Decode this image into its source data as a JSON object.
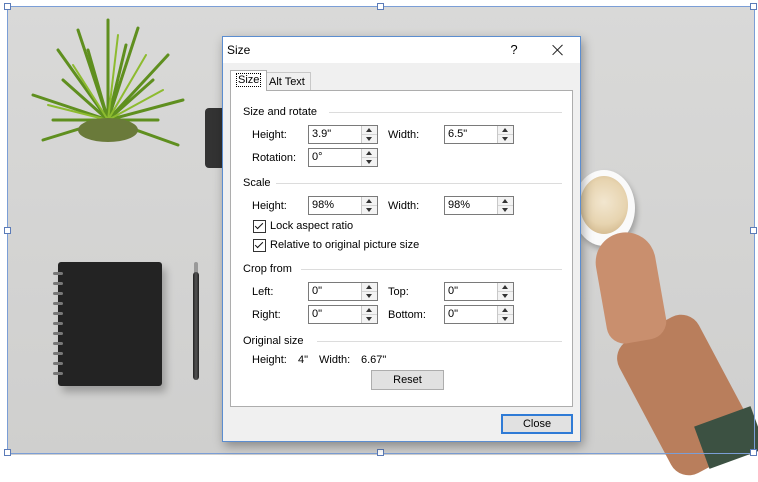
{
  "dialog": {
    "title": "Size",
    "help": "?",
    "tabs": [
      "Size",
      "Alt Text"
    ],
    "size_and_rotate": {
      "heading": "Size and rotate",
      "height_label": "Height:",
      "height_value": "3.9\"",
      "width_label": "Width:",
      "width_value": "6.5\"",
      "rotation_label": "Rotation:",
      "rotation_value": "0°"
    },
    "scale": {
      "heading": "Scale",
      "height_label": "Height:",
      "height_value": "98%",
      "width_label": "Width:",
      "width_value": "98%",
      "lock_aspect_label": "Lock aspect ratio",
      "lock_aspect_checked": true,
      "relative_label": "Relative to original picture size",
      "relative_checked": true
    },
    "crop_from": {
      "heading": "Crop from",
      "left_label": "Left:",
      "left_value": "0\"",
      "top_label": "Top:",
      "top_value": "0\"",
      "right_label": "Right:",
      "right_value": "0\"",
      "bottom_label": "Bottom:",
      "bottom_value": "0\""
    },
    "original_size": {
      "heading": "Original size",
      "height_label": "Height:",
      "height_value": "4\"",
      "width_label": "Width:",
      "width_value": "6.67\"",
      "reset_label": "Reset"
    },
    "close_label": "Close"
  },
  "colors": {
    "selection_frame": "#7b9ed6",
    "dialog_border": "#5b8dd0",
    "default_button_border": "#2f7bd6"
  }
}
